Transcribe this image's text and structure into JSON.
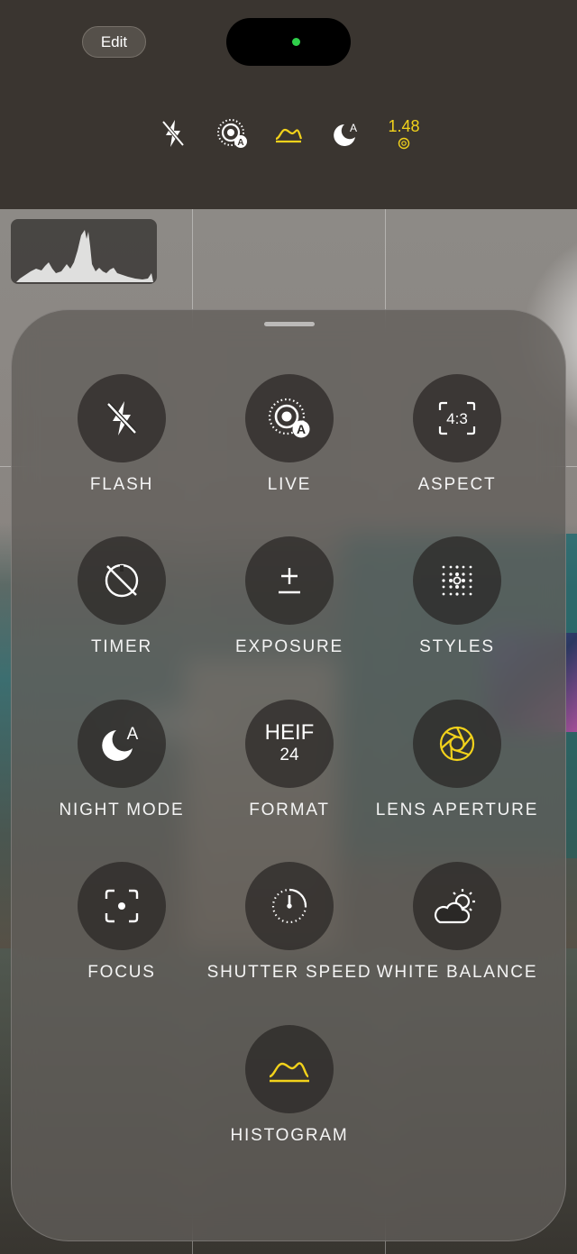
{
  "topbar": {
    "edit_label": "Edit",
    "status_icons": [
      "flash-off-icon",
      "live-auto-icon",
      "histogram-icon",
      "night-mode-auto-icon"
    ],
    "aperture_value": "1.48",
    "accent_color": "#f2d21b"
  },
  "controls": [
    {
      "id": "flash",
      "label": "FLASH",
      "icon": "flash-off-icon"
    },
    {
      "id": "live",
      "label": "LIVE",
      "icon": "live-auto-icon"
    },
    {
      "id": "aspect",
      "label": "ASPECT",
      "icon": "aspect-ratio-icon",
      "icon_text": "4:3"
    },
    {
      "id": "timer",
      "label": "TIMER",
      "icon": "timer-off-icon"
    },
    {
      "id": "exposure",
      "label": "EXPOSURE",
      "icon": "plus-minus-icon"
    },
    {
      "id": "styles",
      "label": "STYLES",
      "icon": "styles-grid-icon"
    },
    {
      "id": "night-mode",
      "label": "NIGHT MODE",
      "icon": "night-mode-auto-icon"
    },
    {
      "id": "format",
      "label": "FORMAT",
      "format_top": "HEIF",
      "format_bottom": "24"
    },
    {
      "id": "lens-aperture",
      "label": "LENS APERTURE",
      "icon": "aperture-icon"
    },
    {
      "id": "focus",
      "label": "FOCUS",
      "icon": "focus-icon"
    },
    {
      "id": "shutter-speed",
      "label": "SHUTTER SPEED",
      "icon": "shutter-dial-icon"
    },
    {
      "id": "white-balance",
      "label": "WHITE BALANCE",
      "icon": "partly-cloudy-icon"
    },
    {
      "id": "histogram",
      "label": "HISTOGRAM",
      "icon": "histogram-icon"
    }
  ]
}
